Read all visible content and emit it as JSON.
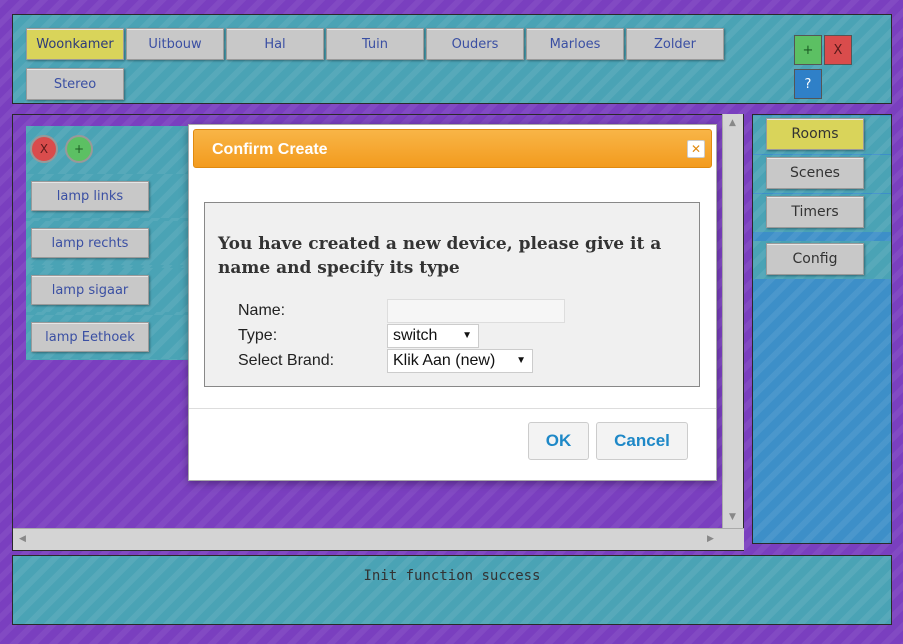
{
  "top_nav": {
    "rooms_row1": [
      "Woonkamer",
      "Uitbouw",
      "Hal",
      "Tuin",
      "Ouders",
      "Marloes",
      "Zolder"
    ],
    "rooms_row2": [
      "Stereo"
    ],
    "active_room": "Woonkamer",
    "add_label": "+",
    "remove_label": "X",
    "help_label": "?"
  },
  "device_panel": {
    "remove_label": "X",
    "add_label": "+",
    "devices": [
      "lamp links",
      "lamp rechts",
      "lamp sigaar",
      "lamp Eethoek"
    ]
  },
  "side_menu": {
    "items": [
      "Rooms",
      "Scenes",
      "Timers",
      "Config"
    ],
    "active": "Rooms"
  },
  "status": {
    "text": "Init function success"
  },
  "dialog": {
    "title": "Confirm Create",
    "close_icon": "close-icon",
    "message": "You have created a new device, please give it a name and specify its type",
    "name_label": "Name:",
    "name_value": "",
    "type_label": "Type:",
    "type_value": "switch",
    "brand_label": "Select Brand:",
    "brand_value": "Klik Aan (new)",
    "ok_label": "OK",
    "cancel_label": "Cancel"
  },
  "colors": {
    "background_purple": "#7a3fbf",
    "panel_teal": "#4aa3b5",
    "panel_blue": "#3d8fc8",
    "active_yellow": "#d9d45a",
    "dialog_orange": "#f39b1e",
    "dialog_button_text": "#1e88c7"
  }
}
